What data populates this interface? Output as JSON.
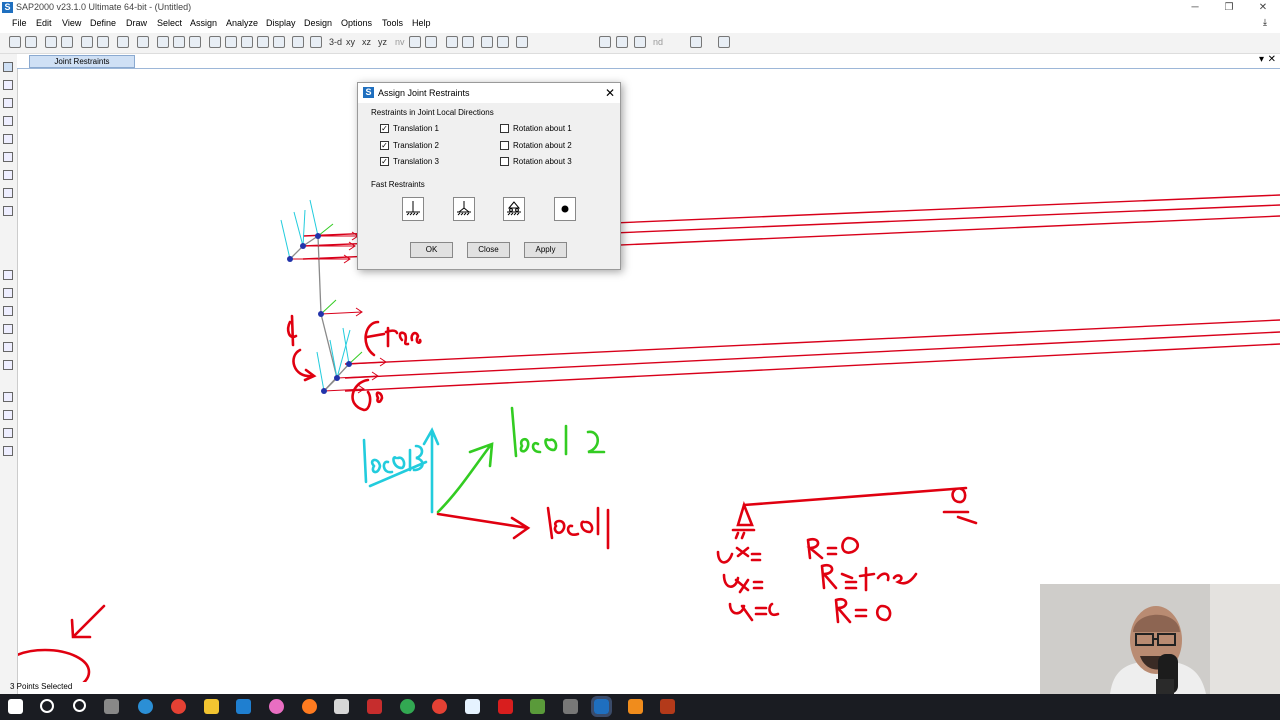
{
  "window": {
    "title": "SAP2000 v23.1.0 Ultimate 64-bit - (Untitled)",
    "app_icon": "S"
  },
  "menu": [
    "File",
    "Edit",
    "View",
    "Define",
    "Draw",
    "Select",
    "Assign",
    "Analyze",
    "Display",
    "Design",
    "Options",
    "Tools",
    "Help"
  ],
  "toolbar": {
    "view_3d": "3-d",
    "view_xy": "xy",
    "view_xz": "xz",
    "view_yz": "yz",
    "view_nv": "nv",
    "view_nd": "nd"
  },
  "tab": {
    "label": "Joint Restraints"
  },
  "dialog": {
    "title": "Assign Joint Restraints",
    "group_local": "Restraints in Joint Local Directions",
    "t1": "Translation 1",
    "t2": "Translation 2",
    "t3": "Translation 3",
    "r1": "Rotation about 1",
    "r2": "Rotation about 2",
    "r3": "Rotation about 3",
    "t1_checked": true,
    "t2_checked": true,
    "t3_checked": true,
    "r1_checked": false,
    "r2_checked": false,
    "r3_checked": false,
    "group_fast": "Fast Restraints",
    "ok": "OK",
    "close": "Close",
    "apply": "Apply"
  },
  "status": {
    "text": "3 Points Selected"
  },
  "colors": {
    "member": "#d8001a",
    "local1_axis": "#d8001a",
    "local2_axis": "#33cc22",
    "local3_axis": "#22ccdd",
    "joint": "#2233aa",
    "annotation": "#e00010"
  },
  "icons": {
    "fast_restraints": [
      "fixed-support-icon",
      "pinned-support-icon",
      "roller-support-icon",
      "free-joint-icon"
    ],
    "taskbar": [
      "windows-start-icon",
      "search-icon",
      "cortana-icon",
      "task-view-icon",
      "edge-icon",
      "chrome-icon",
      "file-explorer-icon",
      "mail-icon",
      "itunes-icon",
      "firefox-icon",
      "app-icon",
      "app-icon",
      "chrome-icon",
      "chrome-icon",
      "app-icon",
      "acrobat-icon",
      "app-icon",
      "app-icon",
      "sap2000-icon",
      "app-icon",
      "app-icon"
    ]
  }
}
